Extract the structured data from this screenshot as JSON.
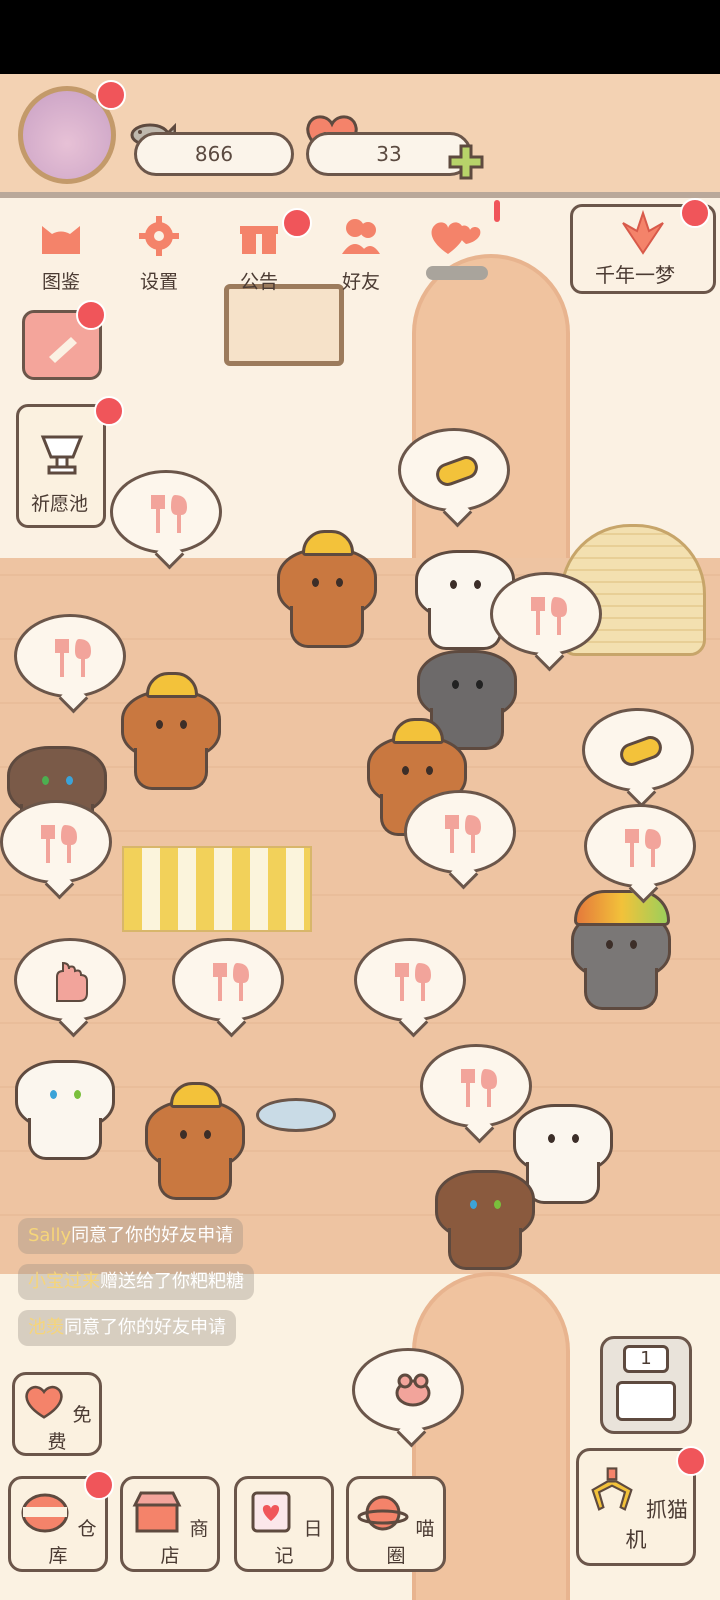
{
  "header": {
    "fish_count": "866",
    "heart_count": "33"
  },
  "nav": [
    {
      "label": "图鉴",
      "icon": "cat-head-icon"
    },
    {
      "label": "设置",
      "icon": "gear-icon"
    },
    {
      "label": "公告",
      "icon": "gift-icon"
    },
    {
      "label": "好友",
      "icon": "friends-icon"
    }
  ],
  "event_banner": {
    "label": "千年一梦"
  },
  "wishing_pool": {
    "label": "祈愿池"
  },
  "feed": [
    {
      "name": "Sally",
      "text": "同意了你的好友申请"
    },
    {
      "name": "小宝过来",
      "text": "赠送给了你粑粑糖"
    },
    {
      "name": "池羡",
      "text": "同意了你的好友申请"
    }
  ],
  "bottom": {
    "free_label": "免费",
    "warehouse_label": "仓库",
    "shop_label": "商店",
    "diary_label": "日记",
    "circle_label": "喵圈",
    "claw_label": "抓猫机",
    "slot_count": "1"
  },
  "colors": {
    "badge": "#f0555a",
    "accent_orange": "#f4836a",
    "outline": "#6b564a"
  }
}
